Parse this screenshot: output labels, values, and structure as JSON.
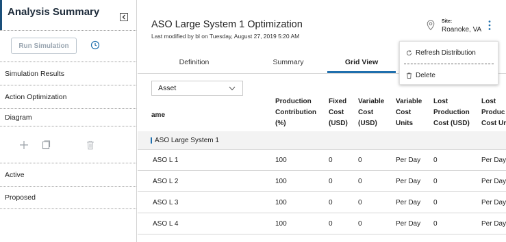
{
  "sidebar": {
    "title": "Analysis Summary",
    "run_button": "Run Simulation",
    "items": [
      {
        "label": "Simulation Results"
      },
      {
        "label": "Action Optimization"
      },
      {
        "label": "Diagram"
      }
    ],
    "bottom_items": [
      {
        "label": "Active"
      },
      {
        "label": "Proposed"
      }
    ],
    "icons": [
      "collapse-icon",
      "clock-icon",
      "plus-icon",
      "copy-icon",
      "trash-icon"
    ]
  },
  "header": {
    "title": "ASO Large System 1 Optimization",
    "subtitle": "Last modified by bl on Tuesday, August 27, 2019 5:20 AM",
    "site_label": "Site:",
    "site_value": "Roanoke, VA"
  },
  "tabs": [
    {
      "label": "Definition"
    },
    {
      "label": "Summary"
    },
    {
      "label": "Grid View",
      "active": true
    }
  ],
  "asset_select": {
    "value": "Asset"
  },
  "table": {
    "columns": [
      {
        "lines": [
          "ame"
        ]
      },
      {
        "lines": [
          "Production",
          "Contribution",
          "(%)"
        ]
      },
      {
        "lines": [
          "Fixed",
          "Cost",
          "(USD)"
        ]
      },
      {
        "lines": [
          "Variable",
          "Cost",
          "(USD)"
        ]
      },
      {
        "lines": [
          "Variable",
          "Cost",
          "Units"
        ]
      },
      {
        "lines": [
          "Lost",
          "Production",
          "Cost (USD)"
        ]
      },
      {
        "lines": [
          "Lost",
          "Produc",
          "Cost Ur"
        ]
      }
    ],
    "group_label": "ASO Large System 1",
    "rows": [
      [
        "ASO L 1",
        "100",
        "0",
        "0",
        "Per Day",
        "0",
        "Per Day"
      ],
      [
        "ASO L 2",
        "100",
        "0",
        "0",
        "Per Day",
        "0",
        "Per Day"
      ],
      [
        "ASO L 3",
        "100",
        "0",
        "0",
        "Per Day",
        "0",
        "Per Day"
      ],
      [
        "ASO L 4",
        "100",
        "0",
        "0",
        "Per Day",
        "0",
        "Per Day"
      ]
    ]
  },
  "menu": {
    "items": [
      {
        "label": "Refresh Distribution",
        "icon": "refresh-icon"
      },
      {
        "label": "Delete",
        "icon": "trash-icon"
      }
    ]
  },
  "colors": {
    "accent": "#1f6fad",
    "sidebar_border": "#1a4f7a",
    "group_row_bg": "#f3f3f3"
  }
}
